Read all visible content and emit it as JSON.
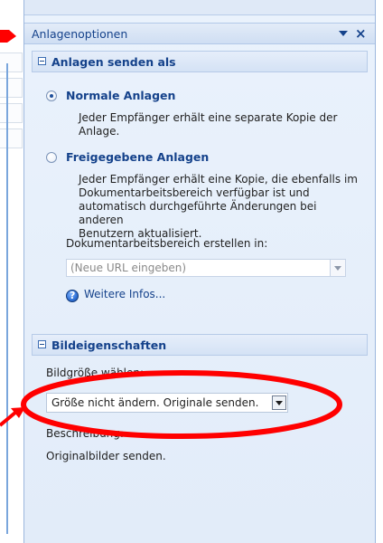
{
  "window": {
    "title": "Anlagenoptionen"
  },
  "section_attach": {
    "title": "Anlagen senden als",
    "options": [
      {
        "label": "Normale Anlagen",
        "description": [
          "Jeder Empfänger erhält eine separate Kopie der",
          "Anlage."
        ],
        "selected": true
      },
      {
        "label": "Freigegebene Anlagen",
        "description": [
          "Jeder Empfänger erhält eine Kopie, die ebenfalls im",
          "Dokumentarbeitsbereich verfügbar ist und",
          "automatisch durchgeführte Änderungen bei anderen",
          "Benutzern aktualisiert."
        ],
        "selected": false
      }
    ],
    "workspace_label": "Dokumentarbeitsbereich erstellen in:",
    "url_placeholder": "(Neue URL eingeben)",
    "more_info": "Weitere Infos..."
  },
  "section_image": {
    "title": "Bildeigenschaften",
    "size_label": "Bildgröße wählen:",
    "size_value": "Größe nicht ändern. Originale senden.",
    "description_label": "Beschreibung:",
    "description_value": "Originalbilder senden."
  },
  "colors": {
    "title_text": "#15428b",
    "pane_background": "#e6eefa",
    "annotation": "#ff0000"
  },
  "icons": [
    "collapse-icon",
    "dropdown-arrow-icon",
    "close-icon",
    "radio-checked-icon",
    "radio-unchecked-icon",
    "info-help-icon",
    "annotation-arrow-icon",
    "annotation-ellipse-icon"
  ]
}
